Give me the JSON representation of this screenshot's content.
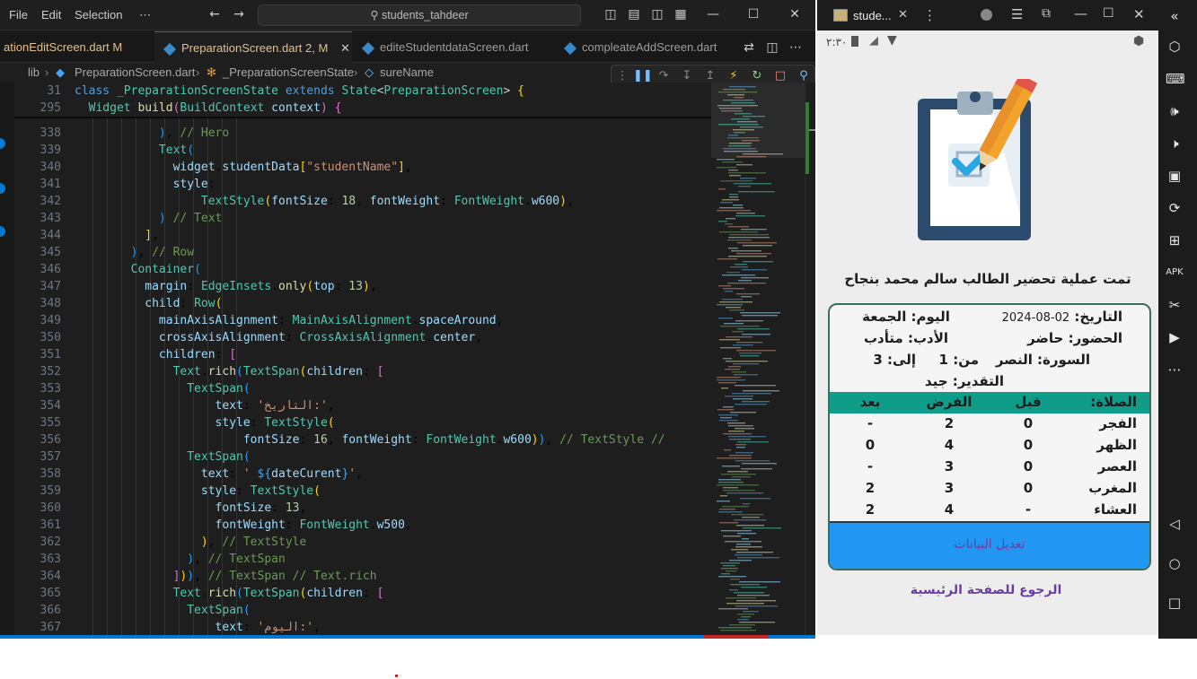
{
  "vscode": {
    "menu": [
      "File",
      "Edit",
      "Selection",
      "⋯"
    ],
    "search": "students_tahdeer",
    "tabs": [
      {
        "label": "ationEditScreen.dart  M",
        "state": "modified"
      },
      {
        "label": "PreparationScreen.dart 2, M",
        "state": "active"
      },
      {
        "label": "editeStudentdataScreen.dart",
        "state": "normal"
      },
      {
        "label": "compleateAddScreen.dart",
        "state": "normal"
      }
    ],
    "breadcrumbs": [
      "lib",
      "PreparationScreen.dart",
      "_PreparationScreenState",
      "sureName"
    ],
    "sticky": [
      {
        "n": "31",
        "html": "<span class='kw'>class</span> <span class='ty'>_PreparationScreenState</span> <span class='kw'>extends</span> <span class='ty'>State</span><span class='pn'>&lt;</span><span class='ty'>PreparationScreen</span><span class='pn'>&gt;</span> <span class='br1'>{</span>"
      },
      {
        "n": "295",
        "html": "  <span class='ty'>Widget</span> <span class='fn'>build</span><span class='br2'>(</span><span class='ty'>BuildContext</span> <span class='vr'>context</span><span class='br2'>)</span> <span class='br2'>{</span>"
      }
    ],
    "lines": [
      {
        "n": "338",
        "html": "            <span class='br3'>)</span>, <span class='cm'>// Hero</span>"
      },
      {
        "n": "339",
        "html": "            <span class='ty'>Text</span><span class='br3'>(</span>"
      },
      {
        "n": "340",
        "html": "              <span class='vr'>widget</span>.<span class='vr'>studentData</span><span class='br1'>[</span><span class='st'>\"studentName\"</span><span class='br1'>]</span>,"
      },
      {
        "n": "341",
        "html": "              <span class='vr'>style</span>:"
      },
      {
        "n": "342",
        "html": "                  <span class='ty'>TextStyle</span><span class='br1'>(</span><span class='vr'>fontSize</span>: <span class='nu'>18</span>, <span class='vr'>fontWeight</span>: <span class='ty'>FontWeight</span>.<span class='vr'>w600</span><span class='br1'>)</span>,"
      },
      {
        "n": "343",
        "html": "            <span class='br3'>)</span> <span class='cm'>// Text</span>"
      },
      {
        "n": "344",
        "html": "          <span class='br1'>]</span>,"
      },
      {
        "n": "345",
        "html": "        <span class='br3'>)</span>, <span class='cm'>// Row</span>"
      },
      {
        "n": "346",
        "html": "        <span class='ty'>Container</span><span class='br3'>(</span>"
      },
      {
        "n": "347",
        "html": "          <span class='vr'>margin</span>: <span class='ty'>EdgeInsets</span>.<span class='fn'>only</span><span class='br1'>(</span><span class='vr'>top</span>: <span class='nu'>13</span><span class='br1'>)</span>,"
      },
      {
        "n": "348",
        "html": "          <span class='vr'>child</span>: <span class='ty'>Row</span><span class='br1'>(</span>"
      },
      {
        "n": "349",
        "html": "            <span class='vr'>mainAxisAlignment</span>: <span class='ty'>MainAxisAlignment</span>.<span class='vr'>spaceAround</span>,"
      },
      {
        "n": "350",
        "html": "            <span class='vr'>crossAxisAlignment</span>: <span class='ty'>CrossAxisAlignment</span>.<span class='vr'>center</span>,"
      },
      {
        "n": "351",
        "html": "            <span class='vr'>children</span>: <span class='br2'>[</span>"
      },
      {
        "n": "352",
        "html": "              <span class='ty'>Text</span>.<span class='fn'>rich</span><span class='br3'>(</span><span class='ty'>TextSpan</span><span class='br1'>(</span><span class='vr'>children</span>: <span class='br2'>[</span>"
      },
      {
        "n": "353",
        "html": "                <span class='ty'>TextSpan</span><span class='br3'>(</span>"
      },
      {
        "n": "354",
        "html": "                    <span class='vr'>text</span>: <span class='st'>'التاريخ:'</span>,"
      },
      {
        "n": "355",
        "html": "                    <span class='vr'>style</span>: <span class='ty'>TextStyle</span><span class='br1'>(</span>"
      },
      {
        "n": "356",
        "html": "                        <span class='vr'>fontSize</span>: <span class='nu'>16</span>, <span class='vr'>fontWeight</span>: <span class='ty'>FontWeight</span>.<span class='vr'>w600</span><span class='br1'>)</span><span class='br3'>)</span>, <span class='cm'>// TextStyle //</span>"
      },
      {
        "n": "357",
        "html": "                <span class='ty'>TextSpan</span><span class='br3'>(</span>"
      },
      {
        "n": "358",
        "html": "                  <span class='vr'>text</span>: <span class='st'>' </span><span class='kw'>${</span><span class='vr'>dateCurent</span><span class='kw'>}</span><span class='st'>'</span>,"
      },
      {
        "n": "359",
        "html": "                  <span class='vr'>style</span>: <span class='ty'>TextStyle</span><span class='br1'>(</span>"
      },
      {
        "n": "360",
        "html": "                    <span class='vr'>fontSize</span>: <span class='nu'>13</span>,"
      },
      {
        "n": "361",
        "html": "                    <span class='vr'>fontWeight</span>: <span class='ty'>FontWeight</span>.<span class='vr'>w500</span>,"
      },
      {
        "n": "362",
        "html": "                  <span class='br1'>)</span>, <span class='cm'>// TextStyle</span>"
      },
      {
        "n": "363",
        "html": "                <span class='br3'>)</span>, <span class='cm'>// TextSpan</span>"
      },
      {
        "n": "364",
        "html": "              <span class='br2'>]</span><span class='br1'>)</span><span class='br3'>)</span>, <span class='cm'>// TextSpan // Text.rich</span>"
      },
      {
        "n": "365",
        "html": "              <span class='ty'>Text</span>.<span class='fn'>rich</span><span class='br3'>(</span><span class='ty'>TextSpan</span><span class='br1'>(</span><span class='vr'>children</span>: <span class='br2'>[</span>"
      },
      {
        "n": "366",
        "html": "                <span class='ty'>TextSpan</span><span class='br3'>(</span>"
      },
      {
        "n": "367",
        "html": "                    <span class='vr'>text</span>: <span class='st'>'اليوم:'</span>,"
      }
    ],
    "colors": {
      "accent": "#0078d4",
      "bg": "#1e1e1e"
    }
  },
  "emulator": {
    "tab_title": "stude...",
    "status_time": "٢:٣٠",
    "success_message": "تمت عملية تحضير الطالب سالم محمد بنجاح",
    "date_label": "التاريخ:",
    "date_value": "02-08-2024",
    "day": "اليوم: الجمعة",
    "attendance": "الحضور: حاضر",
    "manners": "الأدب: متأدب",
    "surah": "السورة: النصر",
    "from": "من: 1",
    "to": "إلى: 3",
    "grade": "التقدير: جيد",
    "table": {
      "headers": [
        "الصلاة:",
        "قبل",
        "الفرض",
        "بعد"
      ],
      "rows": [
        [
          "الفجر",
          "0",
          "2",
          "-"
        ],
        [
          "الظهر",
          "0",
          "4",
          "0"
        ],
        [
          "العصر",
          "0",
          "3",
          "-"
        ],
        [
          "المغرب",
          "0",
          "3",
          "2"
        ],
        [
          "العشاء",
          "-",
          "4",
          "2"
        ]
      ]
    },
    "edit_button": "تعديل البيانات",
    "back_link": "الرجوع للصفحة الرئيسية",
    "colors": {
      "header": "#0f9d8a",
      "button": "#2196f3",
      "card_border": "#3b6e5c",
      "link": "#6a3fa0"
    }
  }
}
